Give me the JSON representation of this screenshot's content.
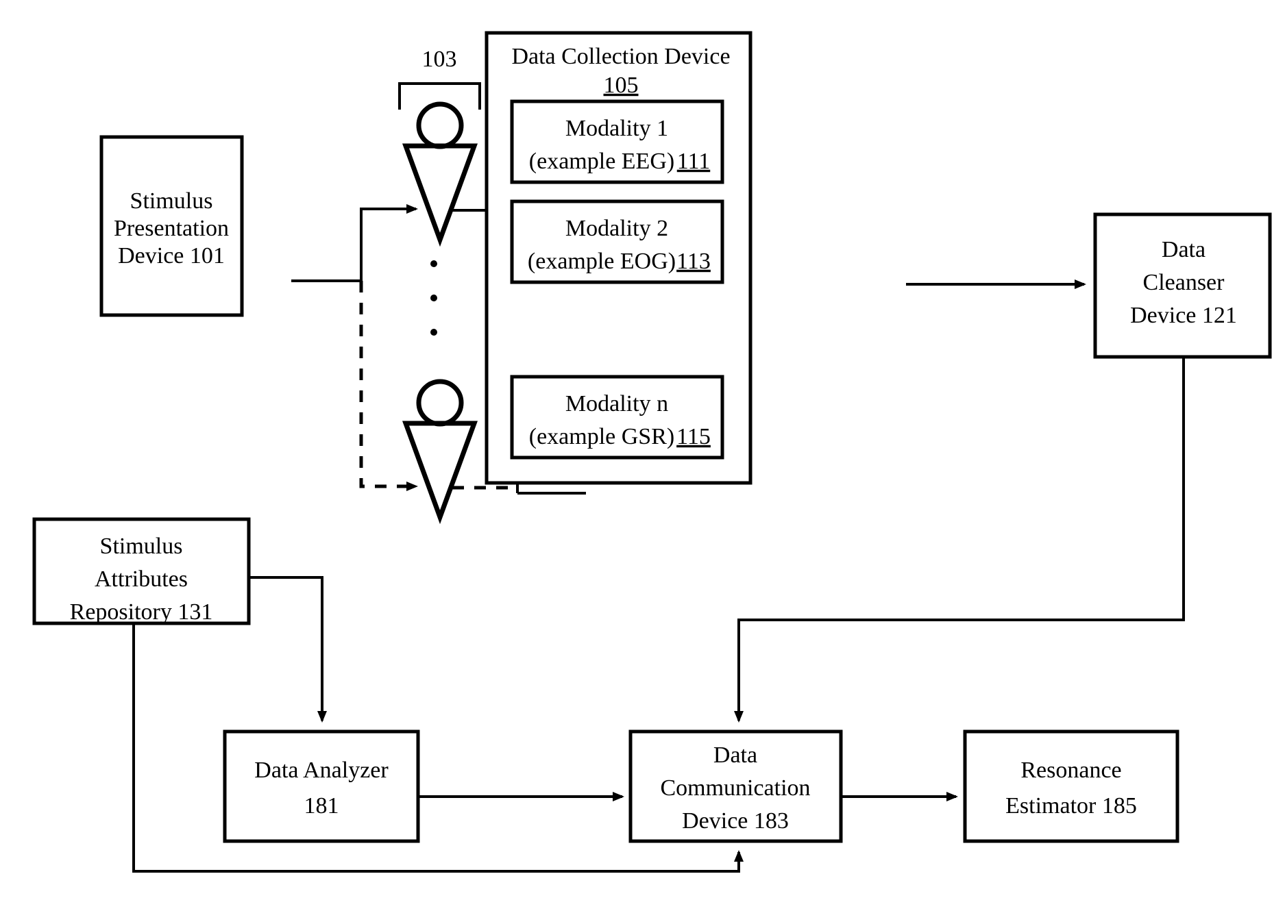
{
  "figure": {
    "type": "patent-block-diagram",
    "background_color": "#ffffff",
    "line_color": "#000000"
  },
  "labels": {
    "group_103": "103"
  },
  "boxes": {
    "stimulus_presentation": {
      "line1": "Stimulus",
      "line2": "Presentation",
      "line3": "Device 101"
    },
    "data_collection": {
      "title": "Data Collection Device",
      "ref": "105"
    },
    "modality1": {
      "line1": "Modality 1",
      "line2": "(example EEG)",
      "ref": "111"
    },
    "modality2": {
      "line1": "Modality 2",
      "line2": "(example EOG)",
      "ref": "113"
    },
    "modalityn": {
      "line1": "Modality n",
      "line2": "(example GSR)",
      "ref": "115"
    },
    "data_cleanser": {
      "line1": "Data",
      "line2": "Cleanser",
      "line3": "Device 121"
    },
    "stimulus_attributes": {
      "line1": "Stimulus",
      "line2": "Attributes",
      "line3": "Repository 131"
    },
    "data_analyzer": {
      "line1": "Data Analyzer",
      "line2": "181"
    },
    "data_communication": {
      "line1": "Data",
      "line2": "Communication",
      "line3": "Device 183"
    },
    "resonance_estimator": {
      "line1": "Resonance",
      "line2": "Estimator 185"
    }
  },
  "icons": {
    "person_top": "person-icon",
    "person_bottom": "person-icon",
    "vertical_ellipsis_subjects": "vertical-ellipsis-icon",
    "vertical_ellipsis_modalities": "vertical-ellipsis-icon"
  }
}
